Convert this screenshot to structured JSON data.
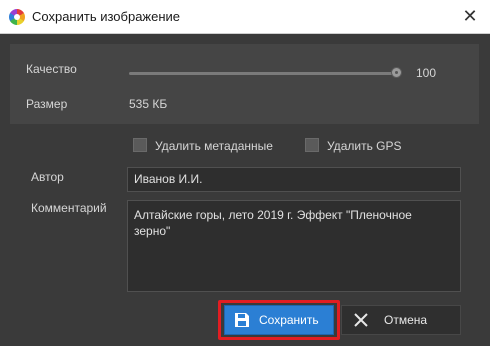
{
  "window": {
    "title": "Сохранить изображение",
    "app_icon": "color-wheel-icon",
    "close_icon": "close-icon"
  },
  "settings": {
    "quality_label": "Качество",
    "quality_value": "100",
    "quality_level": 1.0,
    "size_label": "Размер",
    "size_value": "535 КБ"
  },
  "options": {
    "remove_metadata_label": "Удалить метаданные",
    "remove_metadata_checked": false,
    "remove_gps_label": "Удалить GPS",
    "remove_gps_checked": false
  },
  "author": {
    "label": "Автор",
    "value": "Иванов И.И."
  },
  "comment": {
    "label": "Комментарий",
    "value": "Алтайские горы, лето 2019 г. Эффект \"Пленочное\nзерно\""
  },
  "buttons": {
    "save_label": "Сохранить",
    "save_icon": "floppy-disk-icon",
    "cancel_label": "Отмена",
    "cancel_icon": "close-icon"
  },
  "colors": {
    "accent": "#2b7fd4",
    "highlight": "#e21d22",
    "background": "#3a3a3a"
  }
}
